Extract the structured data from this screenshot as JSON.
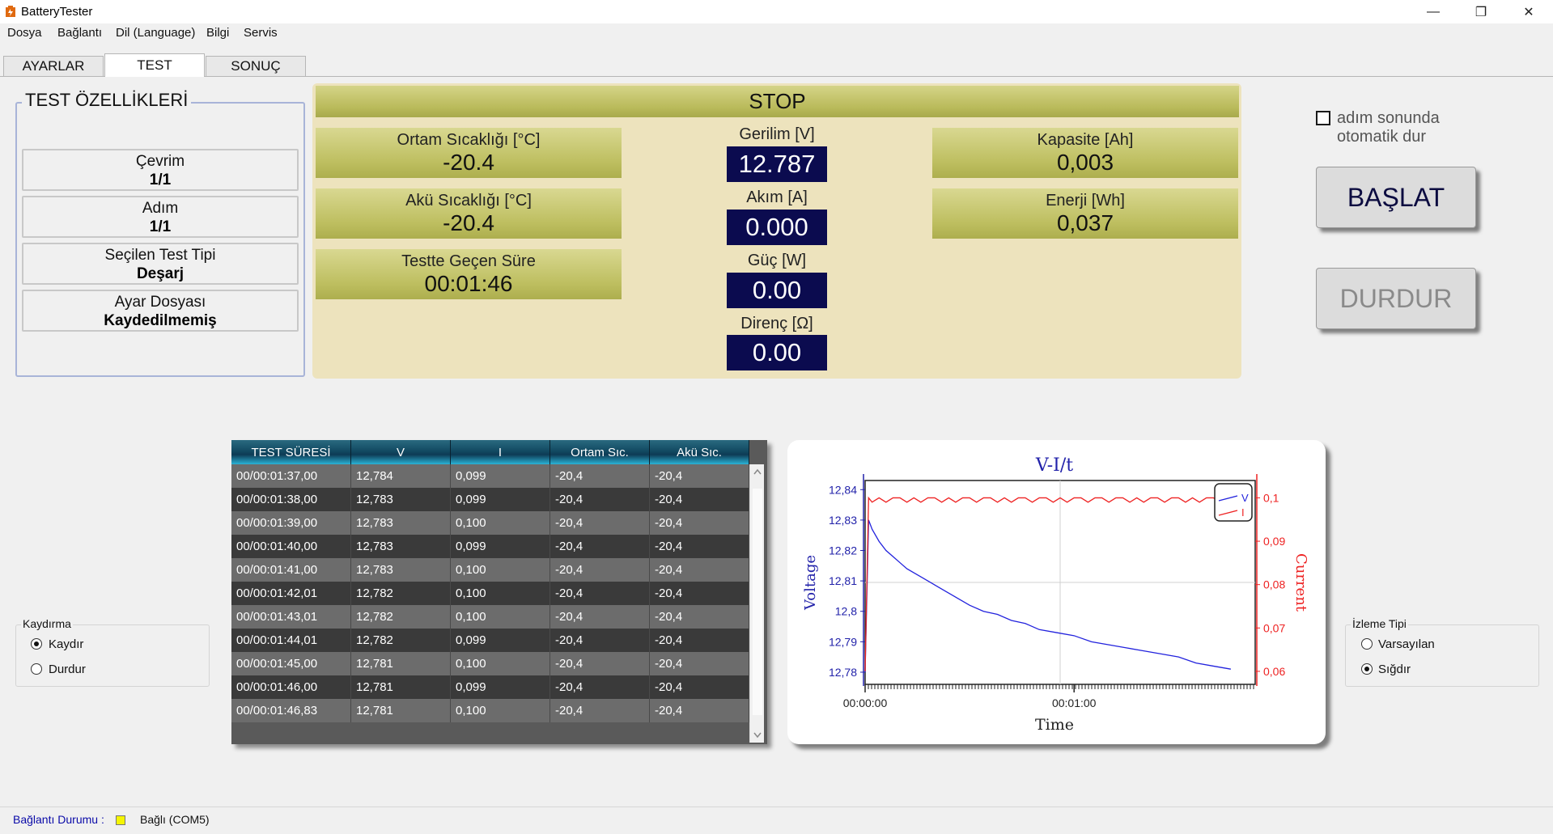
{
  "window": {
    "title": "BatteryTester",
    "icon": "battery-app-icon",
    "minimize_glyph": "—",
    "maximize_glyph": "❐",
    "close_glyph": "✕"
  },
  "menu": [
    "Dosya",
    "Bağlantı",
    "Dil (Language)",
    "Bilgi",
    "Servis"
  ],
  "tabs": [
    {
      "label": "AYARLAR",
      "active": false
    },
    {
      "label": "TEST",
      "active": true
    },
    {
      "label": "SONUÇ",
      "active": false
    }
  ],
  "properties": {
    "title": "TEST ÖZELLİKLERİ",
    "items": [
      {
        "label": "Çevrim",
        "value": "1/1"
      },
      {
        "label": "Adım",
        "value": "1/1"
      },
      {
        "label": "Seçilen Test Tipi",
        "value": "Deşarj"
      },
      {
        "label": "Ayar Dosyası",
        "value": "Kaydedilmemiş"
      }
    ]
  },
  "status": "STOP",
  "left_readings": [
    {
      "label": "Ortam Sıcaklığı [°C]",
      "value": "-20.4"
    },
    {
      "label": "Akü Sıcaklığı [°C]",
      "value": "-20.4"
    },
    {
      "label": "Testte Geçen Süre",
      "value": "00:01:46"
    }
  ],
  "meters": [
    {
      "label": "Gerilim [V]",
      "value": "12.787"
    },
    {
      "label": "Akım [A]",
      "value": "0.000"
    },
    {
      "label": "Güç [W]",
      "value": "0.00"
    },
    {
      "label": "Direnç [Ω]",
      "value": "0.00"
    }
  ],
  "right_readings": [
    {
      "label": "Kapasite [Ah]",
      "value": "0,003"
    },
    {
      "label": "Enerji [Wh]",
      "value": "0,037"
    }
  ],
  "auto_stop": {
    "label_line1": "adım sonunda",
    "label_line2": "otomatik dur",
    "checked": false
  },
  "buttons": {
    "start": "BAŞLAT",
    "stop": "DURDUR"
  },
  "scroll_group": {
    "title": "Kaydırma",
    "options": [
      "Kaydır",
      "Durdur"
    ],
    "selected": 0
  },
  "view_group": {
    "title": "İzleme Tipi",
    "options": [
      "Varsayılan",
      "Sığdır"
    ],
    "selected": 1
  },
  "table": {
    "columns": [
      "TEST SÜRESİ",
      "V",
      "I",
      "Ortam Sıc.",
      "Akü Sıc."
    ],
    "rows": [
      [
        "00/00:01:37,00",
        "12,784",
        "0,099",
        "-20,4",
        "-20,4"
      ],
      [
        "00/00:01:38,00",
        "12,783",
        "0,099",
        "-20,4",
        "-20,4"
      ],
      [
        "00/00:01:39,00",
        "12,783",
        "0,100",
        "-20,4",
        "-20,4"
      ],
      [
        "00/00:01:40,00",
        "12,783",
        "0,099",
        "-20,4",
        "-20,4"
      ],
      [
        "00/00:01:41,00",
        "12,783",
        "0,100",
        "-20,4",
        "-20,4"
      ],
      [
        "00/00:01:42,01",
        "12,782",
        "0,100",
        "-20,4",
        "-20,4"
      ],
      [
        "00/00:01:43,01",
        "12,782",
        "0,100",
        "-20,4",
        "-20,4"
      ],
      [
        "00/00:01:44,01",
        "12,782",
        "0,099",
        "-20,4",
        "-20,4"
      ],
      [
        "00/00:01:45,00",
        "12,781",
        "0,100",
        "-20,4",
        "-20,4"
      ],
      [
        "00/00:01:46,00",
        "12,781",
        "0,099",
        "-20,4",
        "-20,4"
      ],
      [
        "00/00:01:46,83",
        "12,781",
        "0,100",
        "-20,4",
        "-20,4"
      ]
    ]
  },
  "chart_data": {
    "type": "line",
    "title": "V-I/t",
    "xlabel": "Time",
    "ylabel": "Voltage",
    "y2label": "Current",
    "x_ticks": [
      "00:00:00",
      "00:01:00"
    ],
    "y_ticks": [
      "12,84",
      "12,83",
      "12,82",
      "12,81",
      "12,8",
      "12,79",
      "12,78"
    ],
    "y2_ticks": [
      "0,1",
      "0,09",
      "0,08",
      "0,07",
      "0,06"
    ],
    "xlim": [
      0,
      112
    ],
    "ylim": [
      12.776,
      12.843
    ],
    "y2lim": [
      0.057,
      0.104
    ],
    "grid": true,
    "legend_position": "top-right",
    "series": [
      {
        "name": "V",
        "axis": "left",
        "color": "#2222dd",
        "x": [
          0,
          1,
          2,
          4,
          6,
          8,
          10,
          12,
          15,
          18,
          21,
          24,
          27,
          30,
          34,
          38,
          42,
          46,
          50,
          55,
          60,
          65,
          70,
          75,
          80,
          85,
          90,
          95,
          100,
          105
        ],
        "y": [
          12.78,
          12.83,
          12.827,
          12.823,
          12.82,
          12.818,
          12.816,
          12.814,
          12.812,
          12.81,
          12.808,
          12.806,
          12.804,
          12.802,
          12.8,
          12.799,
          12.797,
          12.796,
          12.794,
          12.793,
          12.792,
          12.79,
          12.789,
          12.788,
          12.787,
          12.786,
          12.785,
          12.783,
          12.782,
          12.781
        ]
      },
      {
        "name": "I",
        "axis": "right",
        "color": "#ee2222",
        "x": [
          0,
          1,
          2,
          4,
          6,
          8,
          10,
          12,
          14,
          16,
          18,
          20,
          22,
          24,
          26,
          28,
          30,
          32,
          34,
          36,
          38,
          40,
          42,
          44,
          46,
          48,
          50,
          52,
          54,
          56,
          58,
          60,
          62,
          64,
          66,
          68,
          70,
          72,
          74,
          76,
          78,
          80,
          82,
          84,
          86,
          88,
          90,
          92,
          94,
          96,
          98,
          100,
          102,
          104,
          106
        ],
        "y": [
          0.06,
          0.1,
          0.099,
          0.1,
          0.099,
          0.1,
          0.1,
          0.099,
          0.1,
          0.099,
          0.1,
          0.1,
          0.099,
          0.1,
          0.099,
          0.1,
          0.1,
          0.099,
          0.1,
          0.1,
          0.099,
          0.1,
          0.099,
          0.1,
          0.1,
          0.099,
          0.1,
          0.1,
          0.099,
          0.1,
          0.099,
          0.1,
          0.1,
          0.099,
          0.1,
          0.1,
          0.099,
          0.1,
          0.1,
          0.099,
          0.1,
          0.099,
          0.1,
          0.1,
          0.099,
          0.1,
          0.1,
          0.099,
          0.1,
          0.099,
          0.1,
          0.1,
          0.099,
          0.1,
          0.1
        ]
      }
    ]
  },
  "status_bar": {
    "label": "Bağlantı Durumu :",
    "led_color": "#f5f500",
    "text": "Bağlı (COM5)"
  }
}
